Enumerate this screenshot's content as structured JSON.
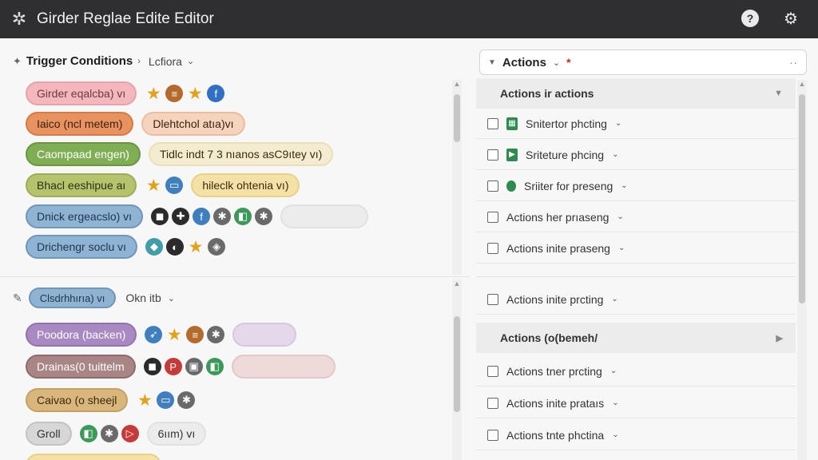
{
  "window": {
    "title": "Girder Reglae Edite Editor"
  },
  "titlebar": {
    "logo_icon": "app-logo-icon",
    "icons": [
      "help-icon",
      "gear-icon"
    ]
  },
  "triggers": {
    "title": "Trigger Conditions",
    "subtitle": "Lcfiora",
    "rows": [
      {
        "pill": "Girder eqalcba) vı",
        "tags": []
      },
      {
        "pill": "Iaico (ncl metem)",
        "tags": [
          "Dlehtchol atıa)vı"
        ]
      },
      {
        "pill": "Caompaad engen)",
        "tags": [
          "Tidlc indt 7 3 nıanos asC9ıtey vı)"
        ]
      },
      {
        "pill": "Bhacl eeshipue aı",
        "tags": [
          "hileclk ohtenia vı)"
        ]
      },
      {
        "pill": "Dnick ergeacslo) vı",
        "tags": []
      },
      {
        "pill": "Drichengr soclu vı",
        "tags": []
      }
    ]
  },
  "section2": {
    "pill": "Clsdrhhırıa) vı",
    "subtitle": "Okn itb",
    "rows": [
      {
        "pill": "Poodora (backen)"
      },
      {
        "pill": "Drainas(0 tuittelm"
      },
      {
        "pill": "Caivao (o sheejl"
      },
      {
        "pill": "Groll",
        "tag": "6ıım) vı"
      }
    ]
  },
  "actions": {
    "title": "Actions",
    "group1": {
      "label": "Actions ir actions"
    },
    "items1": [
      {
        "label": "Snitertor phcting",
        "icon": "sheet-icon"
      },
      {
        "label": "Sriteture phcing",
        "icon": "video-icon"
      },
      {
        "label": "Sriiter for preseng",
        "icon": "dot-icon"
      },
      {
        "label": "Actions her prıaseng",
        "icon": ""
      },
      {
        "label": "Actions inite praseng",
        "icon": ""
      }
    ],
    "mid_item": {
      "label": "Actions inite prcting"
    },
    "group2": {
      "label": "Actions (o(bemeh/"
    },
    "items2": [
      {
        "label": "Actions tner prcting"
      },
      {
        "label": "Actions inite prataıs"
      },
      {
        "label": "Actions tnte phctina"
      }
    ]
  }
}
